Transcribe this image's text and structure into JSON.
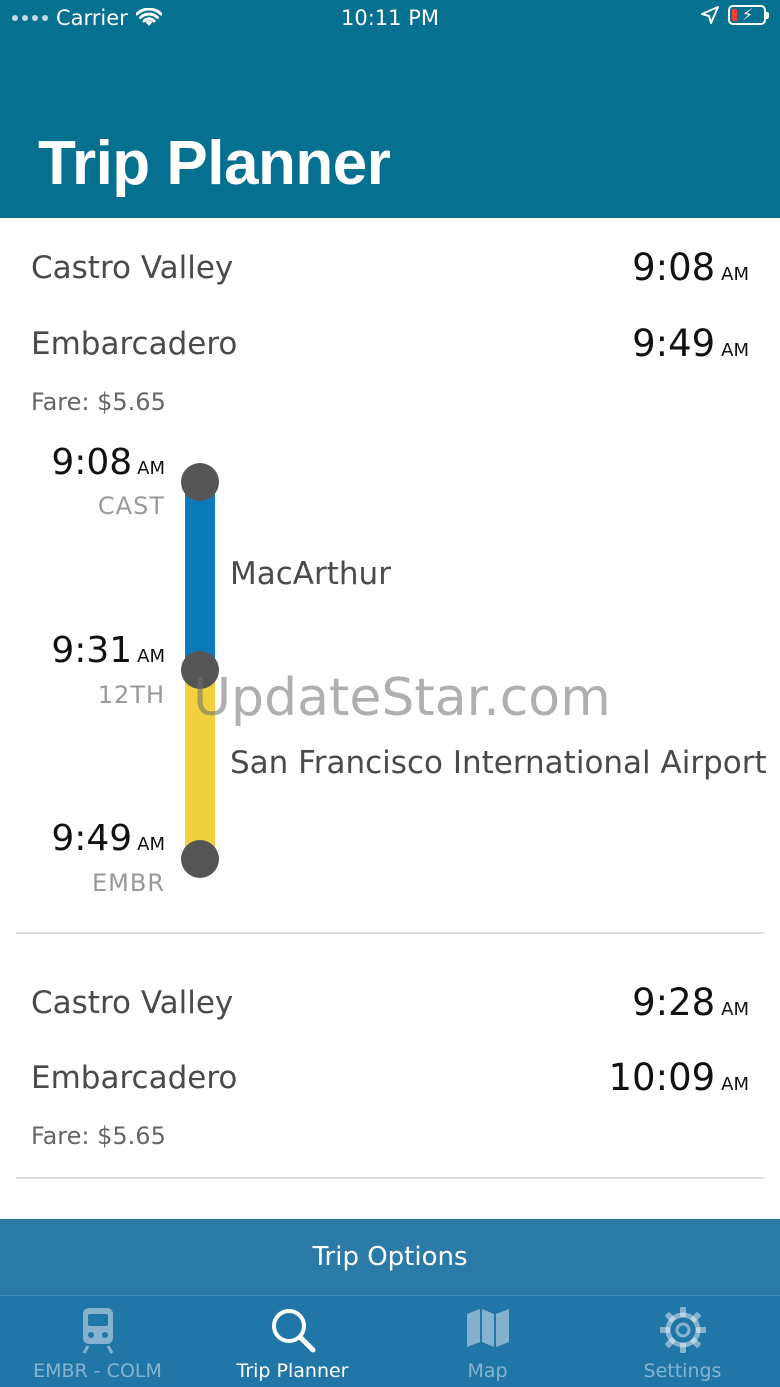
{
  "status_bar": {
    "carrier": "Carrier",
    "time": "10:11 PM"
  },
  "header": {
    "title": "Trip Planner"
  },
  "trips": [
    {
      "origin": "Castro Valley",
      "origin_time": "9:08",
      "origin_ampm": "AM",
      "destination": "Embarcadero",
      "destination_time": "9:49",
      "destination_ampm": "AM",
      "fare": "Fare: $5.65",
      "legs": [
        {
          "line_destination": "MacArthur",
          "line_color": "#0a7bb8"
        },
        {
          "line_destination": "San Francisco International Airport",
          "line_color": "#f1d140"
        }
      ],
      "stops": [
        {
          "time": "9:08",
          "ampm": "AM",
          "code": "CAST"
        },
        {
          "time": "9:31",
          "ampm": "AM",
          "code": "12TH"
        },
        {
          "time": "9:49",
          "ampm": "AM",
          "code": "EMBR"
        }
      ]
    },
    {
      "origin": "Castro Valley",
      "origin_time": "9:28",
      "origin_ampm": "AM",
      "destination": "Embarcadero",
      "destination_time": "10:09",
      "destination_ampm": "AM",
      "fare": "Fare: $5.65"
    }
  ],
  "watermark": "UpdateStar.com",
  "trip_options_label": "Trip Options",
  "tabs": [
    {
      "label": "EMBR - COLM",
      "icon": "train-icon",
      "active": false
    },
    {
      "label": "Trip Planner",
      "icon": "search-icon",
      "active": true
    },
    {
      "label": "Map",
      "icon": "map-icon",
      "active": false
    },
    {
      "label": "Settings",
      "icon": "gear-icon",
      "active": false
    }
  ],
  "colors": {
    "header": "#05708f",
    "tabbar": "#2176a8",
    "trip_options": "#2c7aa8",
    "stop_dot": "#555555"
  }
}
